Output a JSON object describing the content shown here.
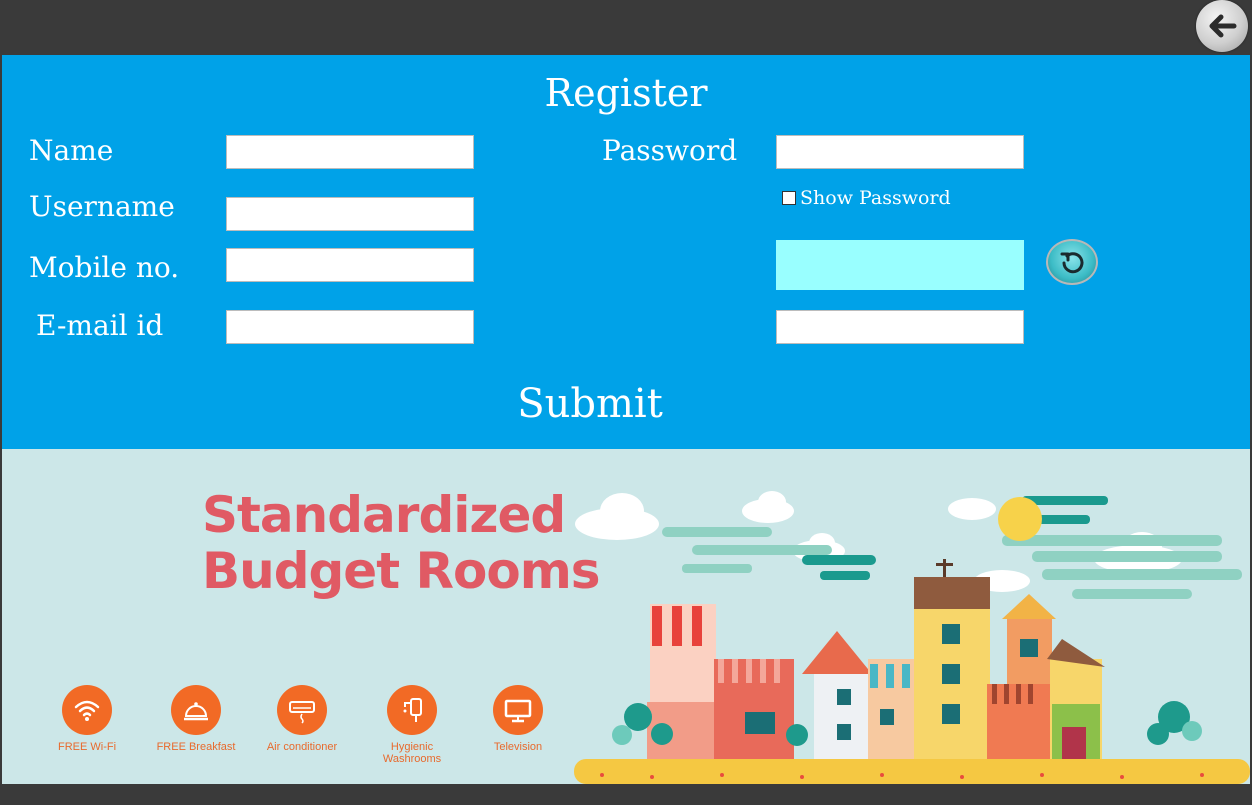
{
  "form": {
    "title": "Register",
    "name_label": "Name",
    "username_label": "Username",
    "mobile_label": "Mobile no.",
    "email_label": "E-mail id",
    "password_label": "Password",
    "show_password_label": "Show Password",
    "show_password_checked": false,
    "submit_label": "Submit",
    "name_value": "",
    "username_value": "",
    "mobile_value": "",
    "email_value": "",
    "password_value": "",
    "captcha_value": "",
    "captcha_input_value": ""
  },
  "banner": {
    "title_line1": "Standardized",
    "title_line2": "Budget Rooms",
    "amenities": [
      {
        "label": "FREE Wi-Fi",
        "icon": "wifi-icon"
      },
      {
        "label": "FREE Breakfast",
        "icon": "breakfast-cloche-icon"
      },
      {
        "label": "Air conditioner",
        "icon": "air-conditioner-icon"
      },
      {
        "label": "Hygienic Washrooms",
        "icon": "washroom-icon"
      },
      {
        "label": "Television",
        "icon": "television-icon"
      }
    ]
  },
  "colors": {
    "form_bg": "#00a2e8",
    "banner_bg": "#cce7e8",
    "banner_title": "#e05a64",
    "amenity": "#f26a25",
    "captcha_bg": "#99ffff",
    "window_frame": "#3a3a3a"
  },
  "icons": {
    "back": "back-arrow-icon",
    "refresh": "refresh-icon"
  }
}
